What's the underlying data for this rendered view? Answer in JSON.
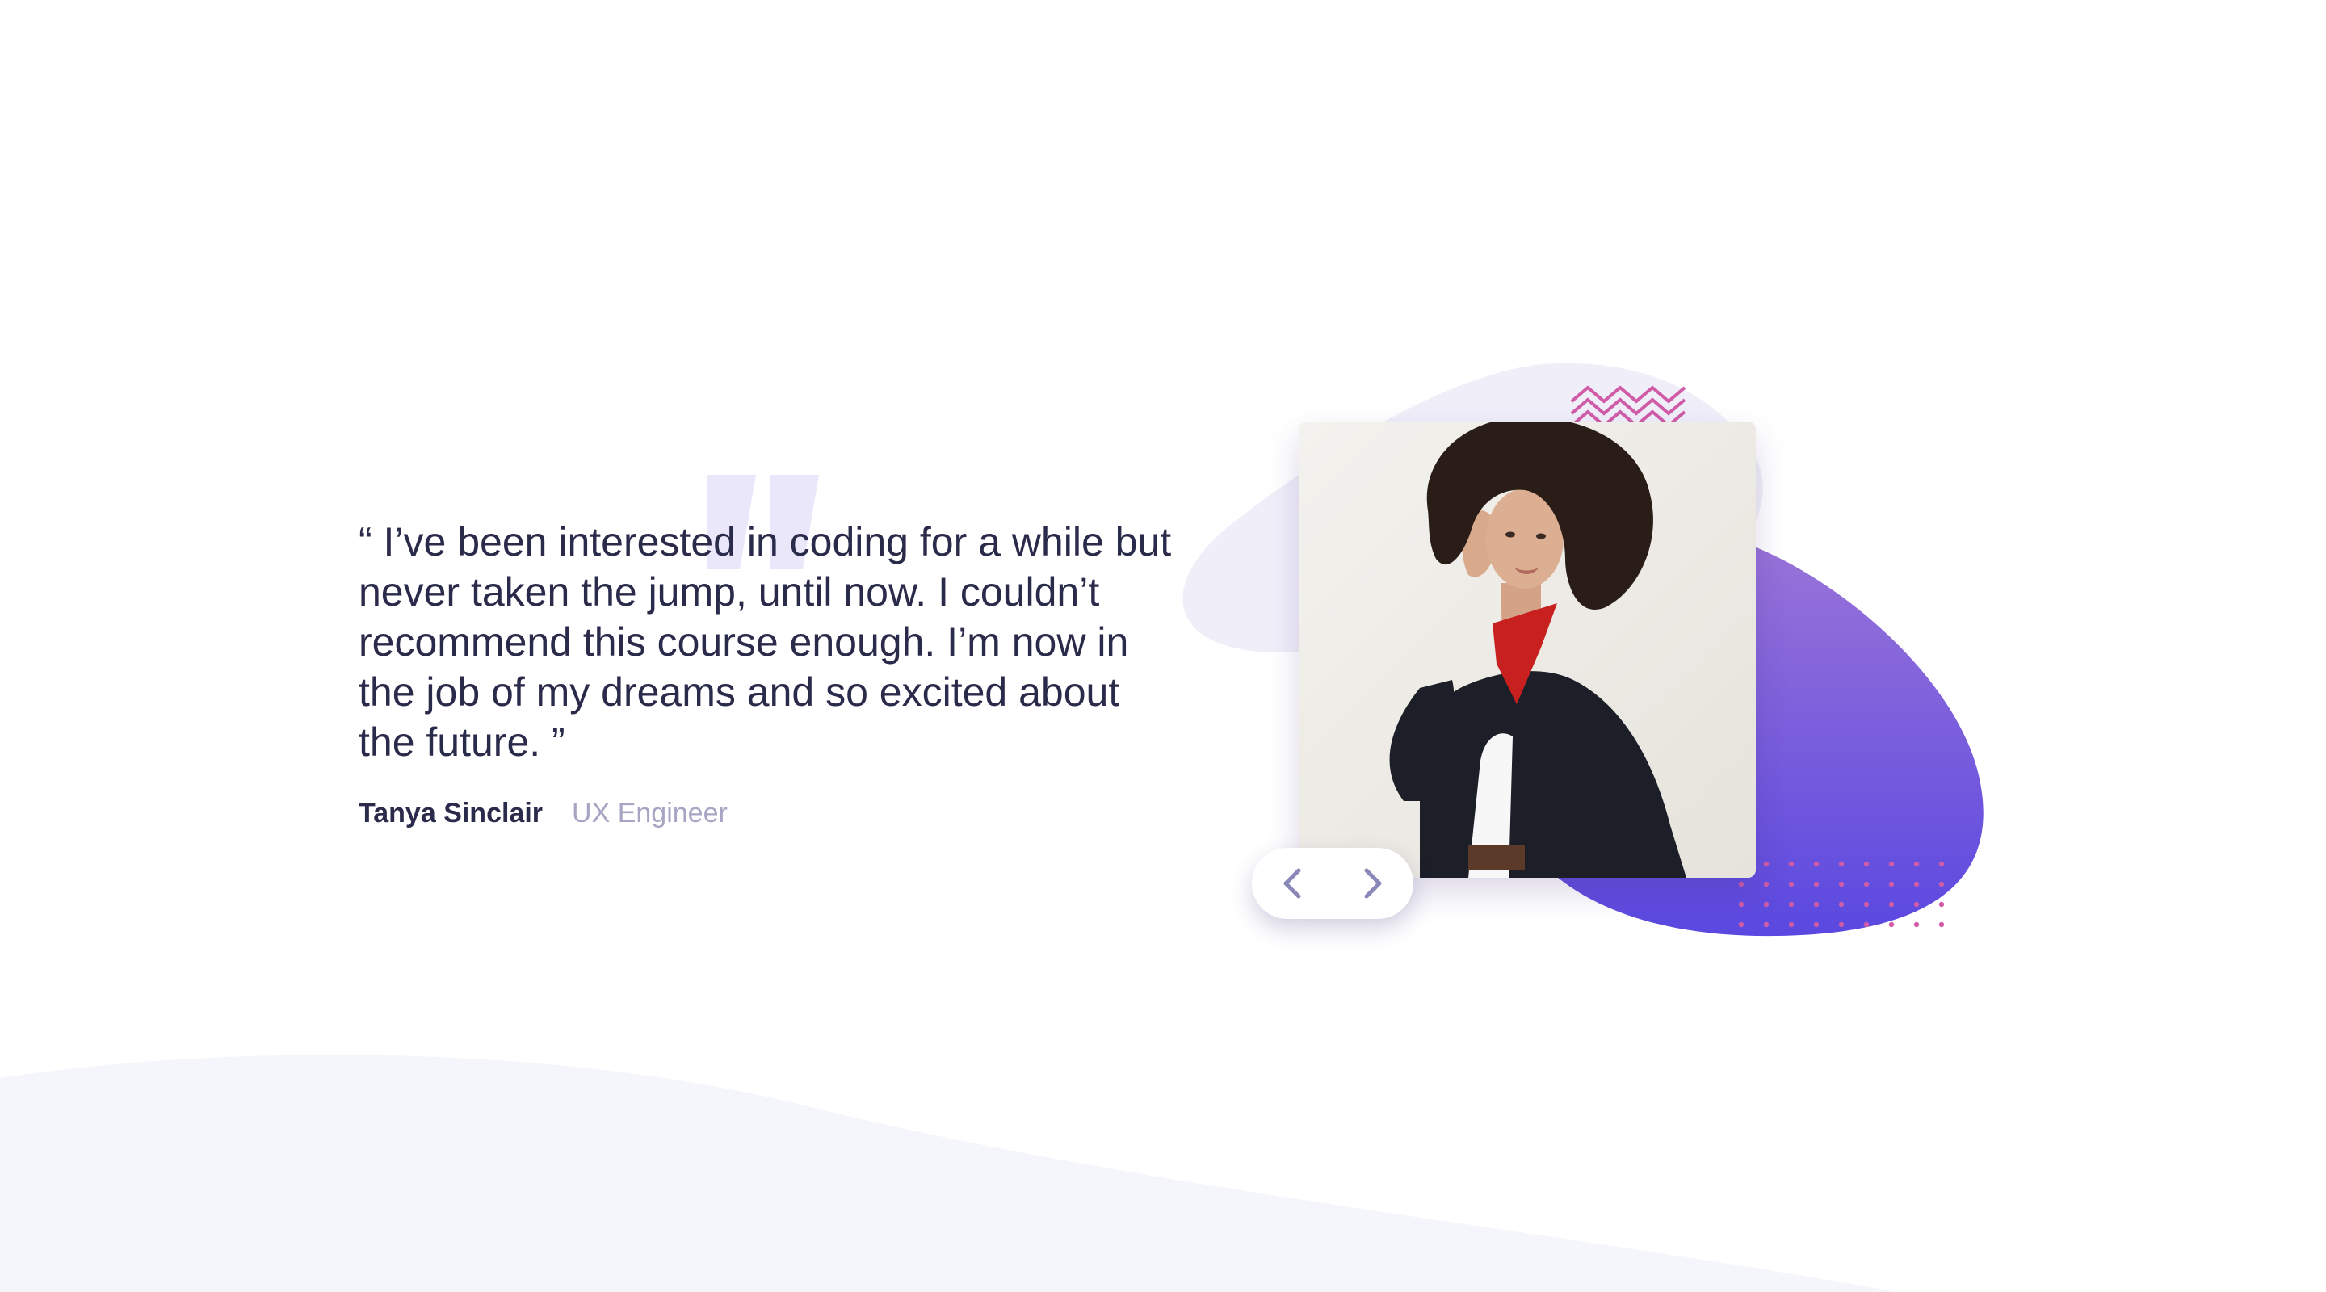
{
  "testimonial": {
    "quote": "“ I’ve been interested in coding for a while but never taken the jump, until now. I couldn’t recommend this course enough. I’m now in the job of my dreams and so excited about the future. ”",
    "author_name": "Tanya Sinclair",
    "author_role": "UX Engineer"
  },
  "navigation": {
    "prev_icon": "chevron-left-icon",
    "next_icon": "chevron-right-icon"
  },
  "colors": {
    "text_primary": "#2a2a4a",
    "text_muted": "#a6a6c4",
    "blob_light": "#f0eff9",
    "gradient_top": "#9a74d8",
    "gradient_bottom": "#5a48e0",
    "accent_pink": "#d05ca8",
    "nav_icon": "#8a88b8",
    "wave": "#f5f5fc"
  }
}
